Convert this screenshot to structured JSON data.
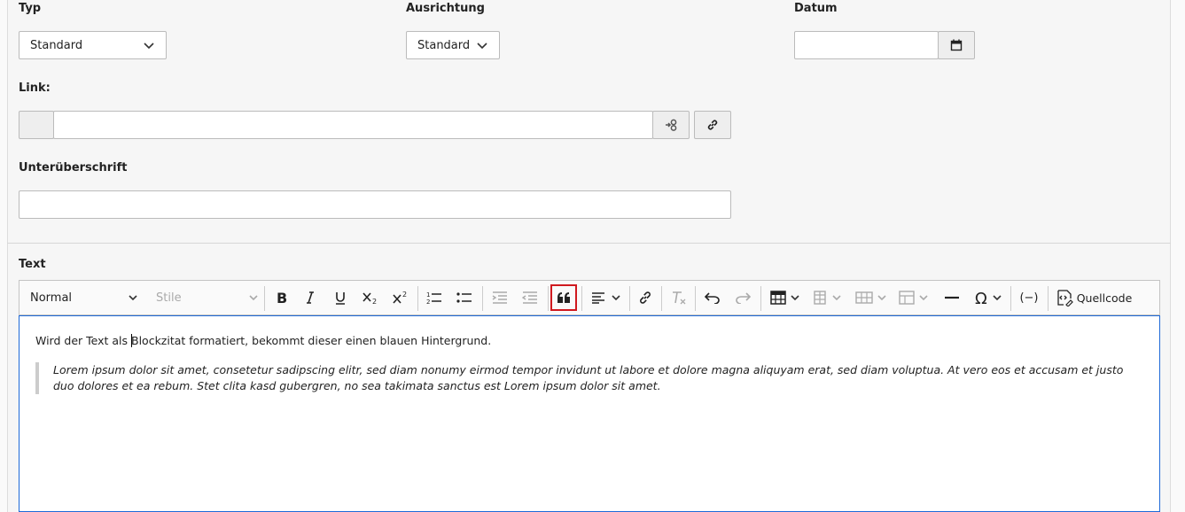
{
  "fields": {
    "typ": {
      "label": "Typ",
      "value": "Standard"
    },
    "ausrichtung": {
      "label": "Ausrichtung",
      "value": "Standard"
    },
    "datum": {
      "label": "Datum",
      "value": ""
    },
    "link": {
      "label": "Link:",
      "value": ""
    },
    "unterueberschrift": {
      "label": "Unterüberschrift",
      "value": ""
    }
  },
  "text": {
    "label": "Text",
    "toolbar": {
      "format": "Normal",
      "styles": "Stile",
      "source_label": "Quellcode",
      "special_char": "(−)",
      "highlighted_button": "blockquote"
    },
    "paragraph": "Wird der Text als Blockzitat formatiert, bekommt dieser einen blauen Hintergrund.",
    "quote": "Lorem ipsum dolor sit amet, consetetur sadipscing elitr, sed diam nonumy eirmod tempor invidunt ut labore et dolore magna aliquyam erat, sed diam voluptua. At vero eos et accusam et justo duo dolores et ea rebum. Stet clita kasd gubergren, no sea takimata sanctus est Lorem ipsum dolor sit amet."
  },
  "colors": {
    "highlight": "#d0191f",
    "focus": "#1f6ad8"
  }
}
